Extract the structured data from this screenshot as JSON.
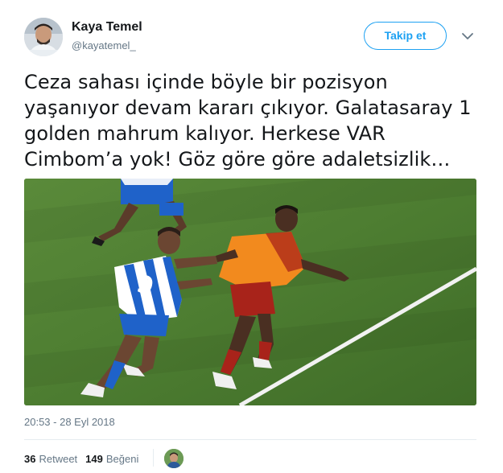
{
  "author": {
    "name": "Kaya Temel",
    "handle": "@kayatemel_"
  },
  "actions": {
    "follow_label": "Takip et",
    "caret_icon": "chevron-down-icon"
  },
  "tweet": {
    "text_lines": [
      "Ceza sahası içinde böyle bir pozisyon",
      "yaşanıyor devam kararı çıkıyor. Galatasaray 1",
      "golden mahrum kalıyor. Herkese VAR",
      "Cimbom’a yok! Göz göre göre adaletsizlik…"
    ],
    "timestamp": "20:53 - 28 Eyl 2018"
  },
  "stats": {
    "retweet_count": "36",
    "retweet_label": "Retweet",
    "like_count": "149",
    "like_label": "Beğeni"
  },
  "colors": {
    "accent": "#1da1f2",
    "secondary_text": "#657786",
    "pitch": "#4b7a30",
    "galatasaray_orange": "#f28a1e",
    "galatasaray_red": "#a8231a",
    "opponent_blue": "#1f62c9"
  }
}
